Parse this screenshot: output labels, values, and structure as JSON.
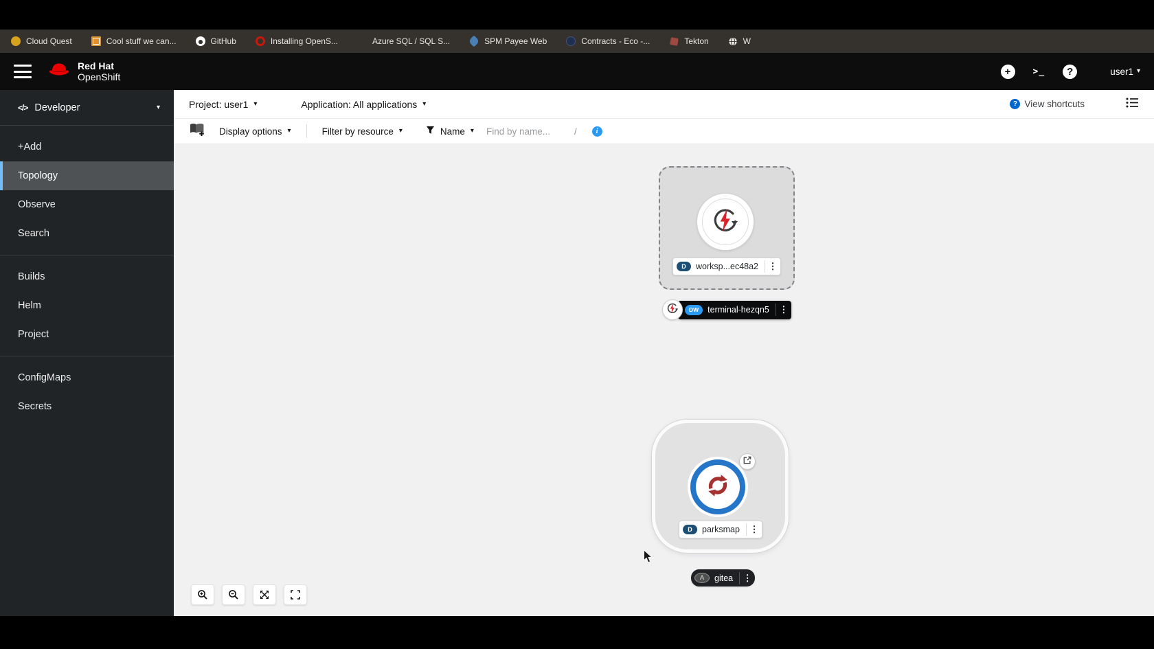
{
  "bookmarks_bar": {
    "items": [
      {
        "label": "Cloud Quest",
        "icon": "yellow-circle-icon"
      },
      {
        "label": "Cool stuff we can...",
        "icon": "orange-frame-icon"
      },
      {
        "label": "GitHub",
        "icon": "github-icon"
      },
      {
        "label": "Installing OpenS...",
        "icon": "openshift-ring-icon"
      },
      {
        "label": "Azure SQL / SQL S...",
        "icon": "microsoft-grid-icon"
      },
      {
        "label": "SPM Payee Web",
        "icon": "blue-feather-icon"
      },
      {
        "label": "Contracts - Eco -...",
        "icon": "navy-circle-icon"
      },
      {
        "label": "Tekton",
        "icon": "tekton-icon"
      },
      {
        "label": "W",
        "icon": "globe-icon"
      }
    ]
  },
  "masthead": {
    "brand_line1": "Red Hat",
    "brand_line2": "OpenShift",
    "user": "user1"
  },
  "sidebar": {
    "perspective": "Developer",
    "items": [
      "+Add",
      "Topology",
      "Observe",
      "Search",
      "Builds",
      "Helm",
      "Project",
      "ConfigMaps",
      "Secrets"
    ],
    "active_item": "Topology"
  },
  "context_bar": {
    "project": "Project: user1",
    "application": "Application: All applications",
    "view_shortcuts": "View shortcuts"
  },
  "filter_bar": {
    "display_options": "Display options",
    "filter_by_resource": "Filter by resource",
    "name": "Name",
    "find_placeholder": "Find by name...",
    "shortcut": "/"
  },
  "topology": {
    "workspace": {
      "badge": "D",
      "label": "worksp...ec48a2"
    },
    "terminal": {
      "badge": "DW",
      "label": "terminal-hezqn5"
    },
    "parksmap": {
      "badge": "D",
      "label": "parksmap"
    },
    "gitea": {
      "badge": "A",
      "label": "gitea"
    }
  },
  "icons": {
    "kebab": "⋮",
    "caret": "▾",
    "terminal_glyph": ">_",
    "plus": "+",
    "question": "?",
    "info": "i",
    "dev_glyph": "</>"
  },
  "colors": {
    "masthead_bg": "#0d0d0d",
    "bookmarks_bg": "#35312c",
    "sidebar_bg": "#212427",
    "active_nav_bg": "#4f5255",
    "active_nav_border": "#73bcf7",
    "accent_blue": "#0066cc",
    "info_blue": "#2b9af3",
    "badge_deployment": "#1d4e73",
    "badge_devworkspace": "#2b9af3",
    "canvas_bg": "#f1f1f2",
    "running_ring_blue": "#2575c9",
    "redhat_red": "#ee0000"
  }
}
